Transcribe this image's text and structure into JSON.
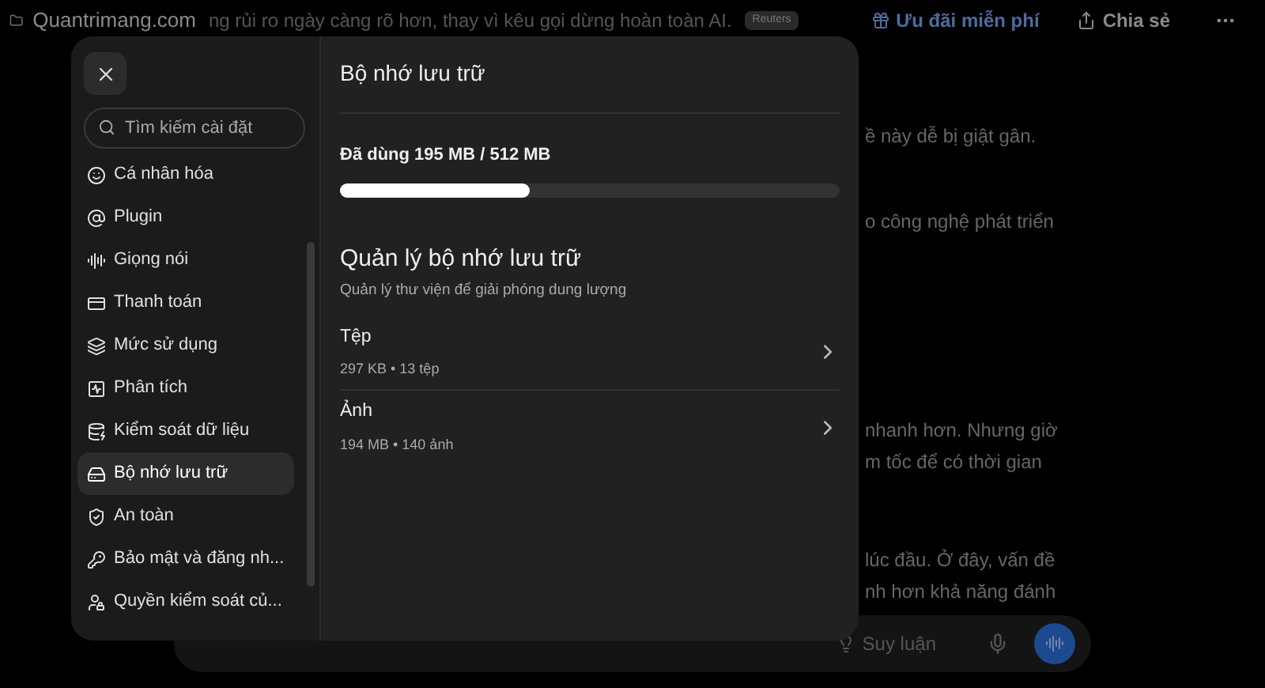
{
  "page": {
    "site_title": "Quantrimang.com",
    "headline_fragment": "ng rủi ro ngày càng rõ hơn, thay vì kêu gọi dừng hoàn toàn AI.",
    "source_badge": "Reuters",
    "offer_link": "Ưu đãi miễn phí",
    "share_button": "Chia sẻ",
    "text_fragments": [
      "ề này dễ bị giật gân.",
      "o công nghệ phát triển",
      "nhanh hơn. Nhưng giờ",
      "m tốc để có thời gian",
      "lúc đầu. Ở đây, vấn đề",
      "nh hơn khả năng đánh"
    ],
    "composer": {
      "reasoning_button": "Suy luận"
    }
  },
  "settings": {
    "search": {
      "placeholder": "Tìm kiếm cài đặt"
    },
    "items": [
      {
        "label": "Cá nhân hóa",
        "selected": false
      },
      {
        "label": "Plugin",
        "selected": false
      },
      {
        "label": "Giọng nói",
        "selected": false
      },
      {
        "label": "Thanh toán",
        "selected": false
      },
      {
        "label": "Mức sử dụng",
        "selected": false
      },
      {
        "label": "Phân tích",
        "selected": false
      },
      {
        "label": "Kiểm soát dữ liệu",
        "selected": false
      },
      {
        "label": "Bộ nhớ lưu trữ",
        "selected": true
      },
      {
        "label": "An toàn",
        "selected": false
      },
      {
        "label": "Bảo mật và đăng nh...",
        "selected": false
      },
      {
        "label": "Quyền kiểm soát củ...",
        "selected": false
      }
    ],
    "panel": {
      "title": "Bộ nhớ lưu trữ",
      "usage_label": "Đã dùng 195 MB / 512 MB",
      "usage": {
        "level": 0.38
      },
      "section_title": "Quản lý bộ nhớ lưu trữ",
      "section_subtitle": "Quản lý thư viện để giải phóng dung lượng",
      "rows": [
        {
          "title": "Tệp",
          "detail": "297 KB • 13 tệp"
        },
        {
          "title": "Ảnh",
          "detail": "194 MB • 140 ảnh"
        }
      ]
    }
  }
}
